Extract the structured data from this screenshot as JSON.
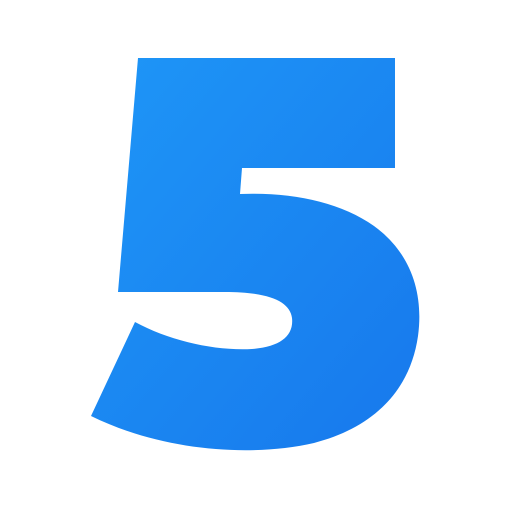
{
  "logo": {
    "glyph": "5",
    "kind": "numeral-logo-icon",
    "colors": {
      "gradient_start": "#1E96F7",
      "gradient_end": "#1778EC",
      "background": "#FFFFFF"
    }
  }
}
